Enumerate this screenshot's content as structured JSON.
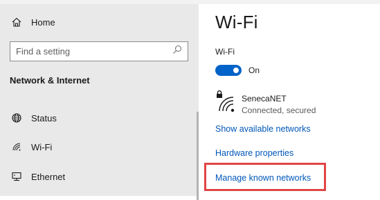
{
  "sidebar": {
    "home_label": "Home",
    "search_placeholder": "Find a setting",
    "section_title": "Network & Internet",
    "items": [
      {
        "label": "Status",
        "icon": "globe-icon"
      },
      {
        "label": "Wi-Fi",
        "icon": "wifi-icon"
      },
      {
        "label": "Ethernet",
        "icon": "ethernet-icon"
      }
    ]
  },
  "main": {
    "title": "Wi-Fi",
    "wifi_toggle_label": "Wi-Fi",
    "wifi_toggle_state": "On",
    "network": {
      "name": "SenecaNET",
      "status": "Connected, secured",
      "icon": "secured-wifi-icon"
    },
    "links": {
      "show_available": "Show available networks",
      "hardware_properties": "Hardware properties",
      "manage_known": "Manage known networks"
    }
  },
  "colors": {
    "accent": "#0063c9",
    "link": "#0057b8",
    "sidebar_bg": "#e9e9e9",
    "highlight": "#e04444"
  }
}
